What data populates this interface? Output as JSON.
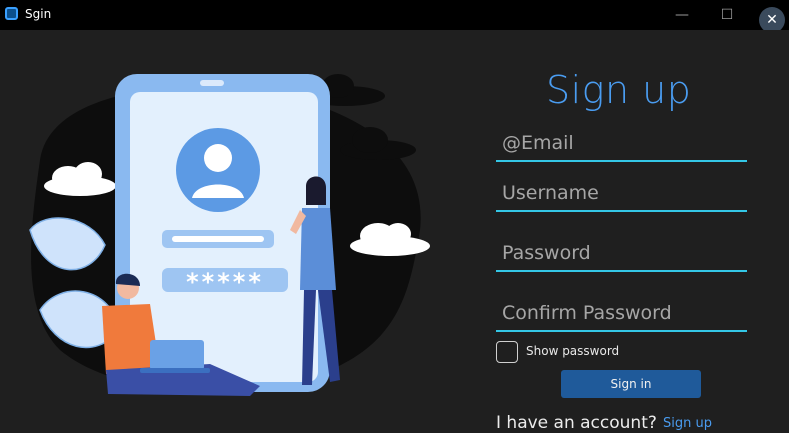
{
  "window": {
    "title": "Sgin",
    "minimize_glyph": "—",
    "maximize_glyph": "☐",
    "close_glyph": "✕",
    "accent_color": "#3aa0ff"
  },
  "illustration": {
    "masked_password_text": "*****",
    "icons": [
      "user-avatar-icon",
      "cloud-icon",
      "leaf-icon",
      "laptop-icon"
    ]
  },
  "form": {
    "heading": "Sign up",
    "email_placeholder": "@Email",
    "username_placeholder": "Username",
    "password_placeholder": "Password",
    "confirm_password_placeholder": "Confirm Password",
    "show_password_label": "Show password",
    "show_password_checked": false,
    "signin_button_label": "Sign in",
    "account_prompt": "I have an account?",
    "signup_link_label": "Sign up",
    "underline_color": "#34c7e6",
    "heading_color": "#4a9cf0",
    "button_color": "#1f5a9a"
  }
}
